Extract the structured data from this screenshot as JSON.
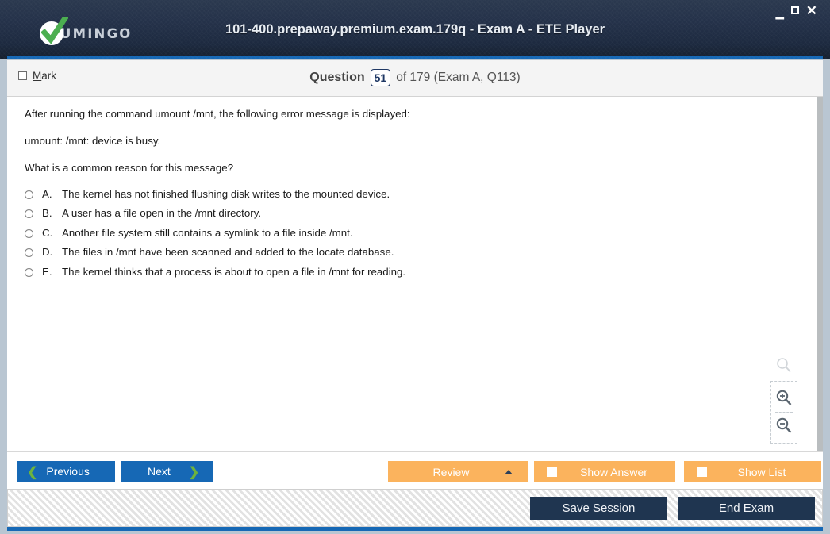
{
  "window": {
    "title": "101-400.prepaway.premium.exam.179q - Exam A - ETE Player",
    "logo_text": "UMINGO",
    "controls": {
      "minimize": "—",
      "maximize": "□",
      "close": "✕"
    },
    "accent_blue": "#1668b5",
    "titlebar_dark": "#1d2a40",
    "logo_green": "#4caf50"
  },
  "header": {
    "mark_label_prefix": "M",
    "mark_label_rest": "ark",
    "question_word": "Question",
    "question_number": "51",
    "question_of": "of 179 (Exam A, Q113)"
  },
  "question": {
    "lines": [
      "After running the command umount /mnt, the following error message is displayed:",
      "umount: /mnt: device is busy.",
      "What is a common reason for this message?"
    ],
    "options": [
      {
        "letter": "A.",
        "text": "The kernel has not finished flushing disk writes to the mounted device.",
        "selected": false
      },
      {
        "letter": "B.",
        "text": "A user has a file open in the /mnt directory.",
        "selected": false
      },
      {
        "letter": "C.",
        "text": "Another file system still contains a symlink to a file inside /mnt.",
        "selected": false
      },
      {
        "letter": "D.",
        "text": "The files in /mnt have been scanned and added to the locate database.",
        "selected": false
      },
      {
        "letter": "E.",
        "text": "The kernel thinks that a process is about to open a file in /mnt for reading.",
        "selected": false
      }
    ]
  },
  "zoom_tools": {
    "search_icon": "magnifier-icon",
    "zoom_in_icon": "magnifier-plus-icon",
    "zoom_out_icon": "magnifier-minus-icon"
  },
  "actions": {
    "previous": "Previous",
    "next": "Next",
    "review": "Review",
    "show_answer": "Show Answer",
    "show_list": "Show List",
    "orange": "#fbb35d"
  },
  "footer": {
    "save_session": "Save Session",
    "end_exam": "End Exam",
    "navy": "#1f3550"
  }
}
